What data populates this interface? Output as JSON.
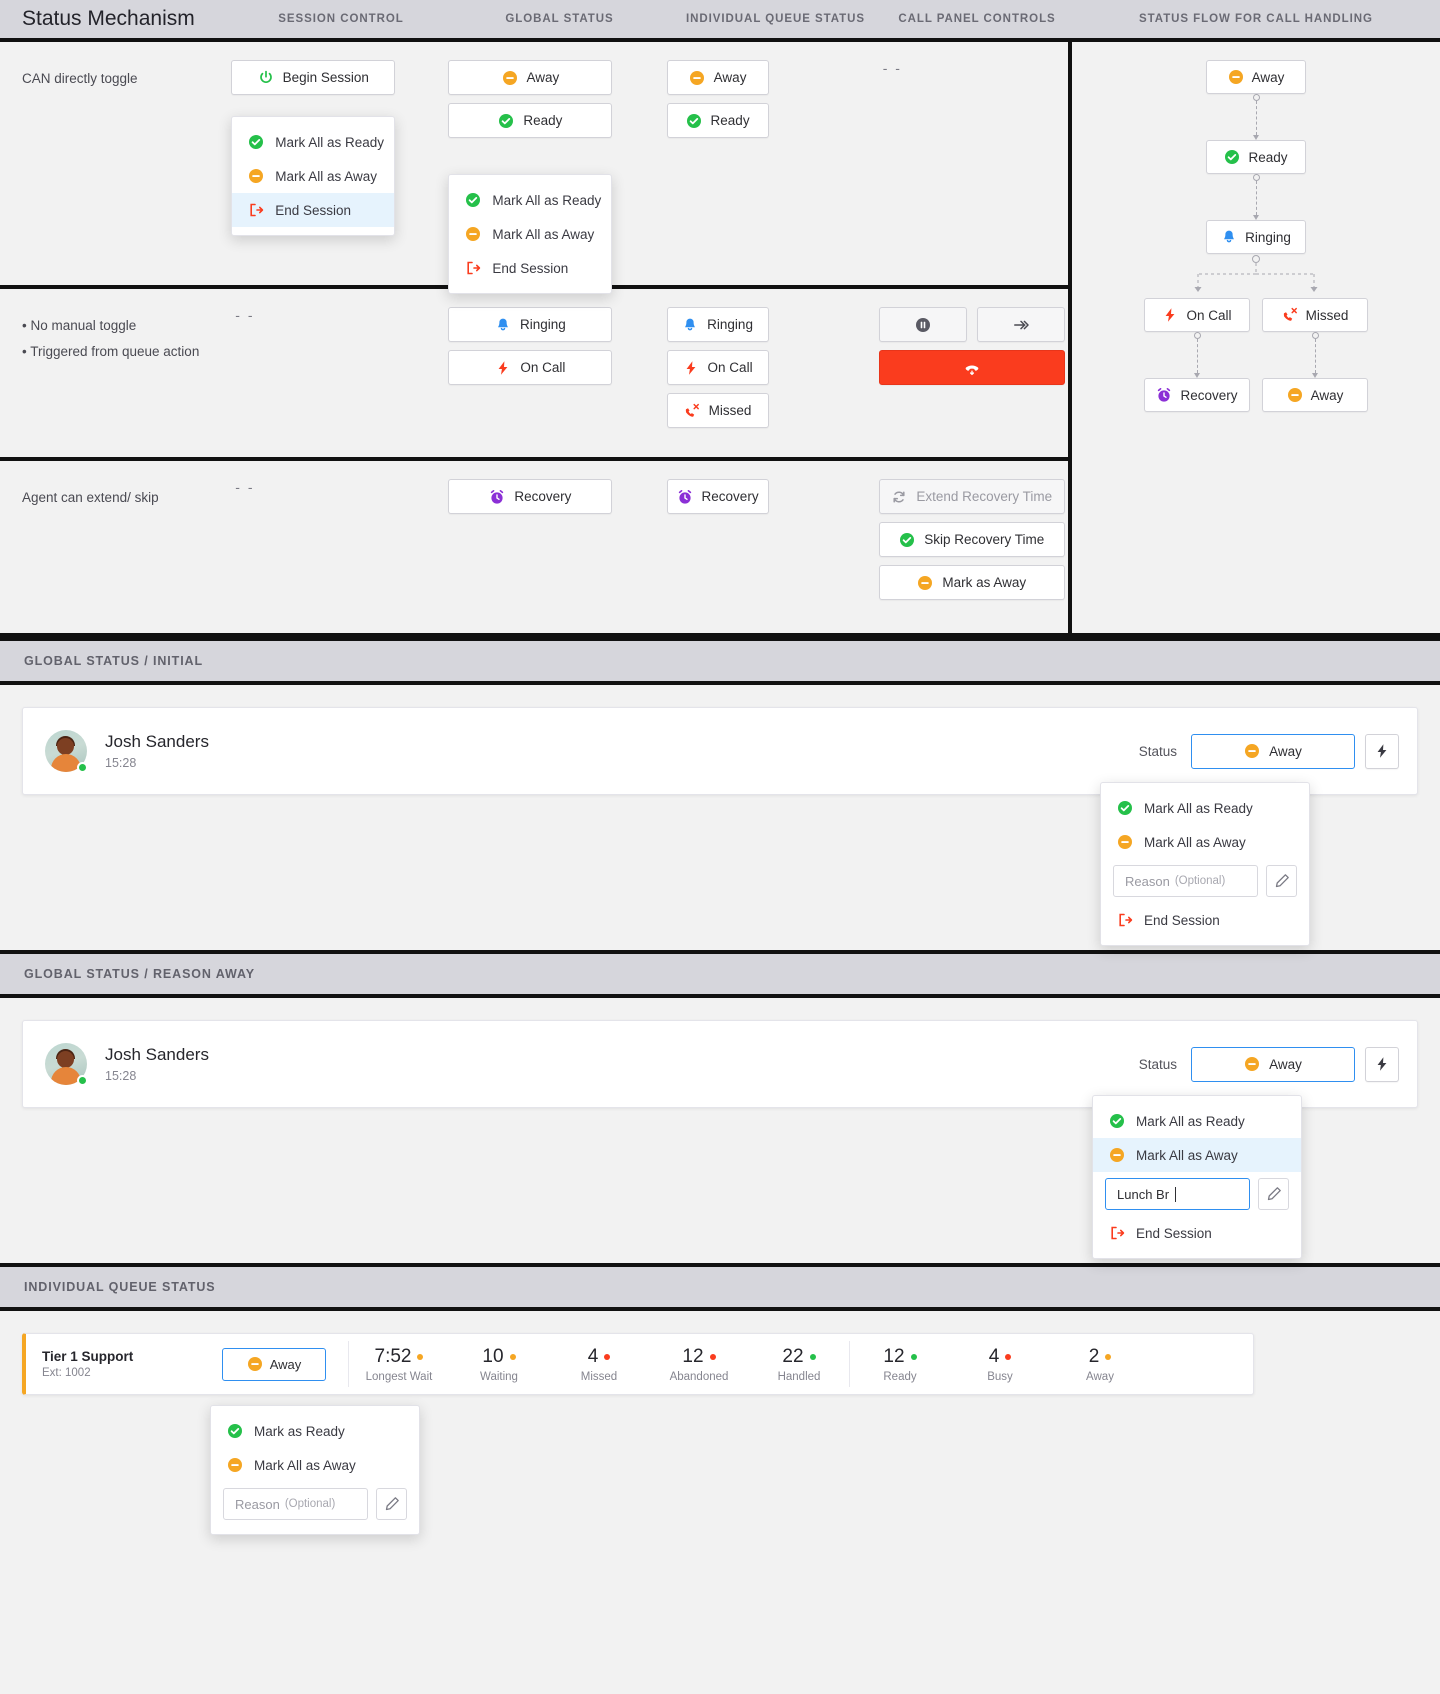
{
  "header": {
    "title": "Status Mechanism",
    "columns": [
      {
        "label": "SESSION CONTROL"
      },
      {
        "label": "GLOBAL STATUS"
      },
      {
        "label": "INDIVIDUAL QUEUE STATUS"
      },
      {
        "label": "CALL PANEL CONTROLS"
      },
      {
        "label": "STATUS FLOW FOR CALL HANDLING"
      }
    ]
  },
  "matrix": {
    "row1": {
      "label": "CAN directly toggle",
      "session": {
        "button": "Begin Session",
        "menu": [
          {
            "label": "Mark All as Ready",
            "icon": "check-circle-icon"
          },
          {
            "label": "Mark All as Away",
            "icon": "minus-circle-icon"
          },
          {
            "label": "End Session",
            "icon": "exit-icon",
            "highlighted": true
          }
        ]
      },
      "global": {
        "buttons": [
          {
            "label": "Away",
            "icon": "minus-circle-icon"
          },
          {
            "label": "Ready",
            "icon": "check-circle-icon"
          }
        ],
        "menu": [
          {
            "label": "Mark All as Ready",
            "icon": "check-circle-icon"
          },
          {
            "label": "Mark All as Away",
            "icon": "minus-circle-icon"
          },
          {
            "label": "End Session",
            "icon": "exit-icon"
          }
        ]
      },
      "queue": {
        "buttons": [
          {
            "label": "Away",
            "icon": "minus-circle-icon"
          },
          {
            "label": "Ready",
            "icon": "check-circle-icon"
          }
        ]
      },
      "panel_placeholder": "- -"
    },
    "row2": {
      "label_lines": [
        "• No manual toggle",
        "• Triggered from queue action"
      ],
      "session_placeholder": "- -",
      "global": {
        "buttons": [
          {
            "label": "Ringing",
            "icon": "bell-icon"
          },
          {
            "label": "On Call",
            "icon": "bolt-icon"
          }
        ]
      },
      "queue": {
        "buttons": [
          {
            "label": "Ringing",
            "icon": "bell-icon"
          },
          {
            "label": "On Call",
            "icon": "bolt-icon"
          },
          {
            "label": "Missed",
            "icon": "missed-call-icon"
          }
        ]
      },
      "panel": {
        "hold_icon": "pause-icon",
        "transfer_icon": "forward-icon",
        "hangup_icon": "hangup-icon"
      }
    },
    "row3": {
      "label": "Agent can extend/ skip",
      "session_placeholder": "- -",
      "global": {
        "buttons": [
          {
            "label": "Recovery",
            "icon": "alarm-icon"
          }
        ]
      },
      "queue": {
        "buttons": [
          {
            "label": "Recovery",
            "icon": "alarm-icon"
          }
        ]
      },
      "panel": {
        "buttons": [
          {
            "label": "Extend Recovery Time",
            "icon": "refresh-icon",
            "disabled": true
          },
          {
            "label": "Skip Recovery Time",
            "icon": "check-circle-icon"
          },
          {
            "label": "Mark as Away",
            "icon": "minus-circle-icon"
          }
        ]
      }
    }
  },
  "flow": {
    "nodes": [
      {
        "label": "Away",
        "icon": "minus-circle-icon"
      },
      {
        "label": "Ready",
        "icon": "check-circle-icon"
      },
      {
        "label": "Ringing",
        "icon": "bell-icon"
      }
    ],
    "branch_left": {
      "label": "On Call",
      "icon": "bolt-icon"
    },
    "branch_right": {
      "label": "Missed",
      "icon": "missed-call-icon"
    },
    "leaf_left": {
      "label": "Recovery",
      "icon": "alarm-icon"
    },
    "leaf_right": {
      "label": "Away",
      "icon": "minus-circle-icon"
    }
  },
  "section_initial": {
    "band": "GLOBAL STATUS / INITIAL",
    "agent": {
      "name": "Josh Sanders",
      "time": "15:28",
      "status_label": "Status",
      "status_value": "Away",
      "status_icon": "minus-circle-icon",
      "action_icon": "bolt-icon"
    },
    "menu": {
      "items": [
        {
          "label": "Mark All as Ready",
          "icon": "check-circle-icon"
        },
        {
          "label": "Mark All as Away",
          "icon": "minus-circle-icon"
        }
      ],
      "reason_placeholder": "Reason",
      "reason_optional": "(Optional)",
      "reason_value": "",
      "edit_icon": "pencil-icon",
      "end_session": "End Session",
      "end_session_icon": "exit-icon"
    }
  },
  "section_reason": {
    "band": "GLOBAL STATUS / REASON AWAY",
    "agent": {
      "name": "Josh Sanders",
      "time": "15:28",
      "status_label": "Status",
      "status_value": "Away",
      "status_icon": "minus-circle-icon",
      "action_icon": "bolt-icon"
    },
    "menu": {
      "items": [
        {
          "label": "Mark All as Ready",
          "icon": "check-circle-icon",
          "highlighted": false
        },
        {
          "label": "Mark All as Away",
          "icon": "minus-circle-icon",
          "highlighted": true
        }
      ],
      "reason_value": "Lunch Br",
      "edit_icon": "pencil-icon",
      "end_session": "End Session",
      "end_session_icon": "exit-icon"
    }
  },
  "section_queue": {
    "band": "INDIVIDUAL QUEUE STATUS",
    "queue": {
      "name": "Tier 1 Support",
      "ext": "Ext: 1002",
      "status_value": "Away",
      "status_icon": "minus-circle-icon"
    },
    "metrics": [
      {
        "value": "7:52",
        "label": "Longest Wait",
        "color": "#f5a623"
      },
      {
        "value": "10",
        "label": "Waiting",
        "color": "#f5a623"
      },
      {
        "value": "4",
        "label": "Missed",
        "color": "#fa3c1e"
      },
      {
        "value": "12",
        "label": "Abandoned",
        "color": "#fa3c1e"
      },
      {
        "value": "22",
        "label": "Handled",
        "color": "#25c04a"
      },
      {
        "value": "12",
        "label": "Ready",
        "color": "#25c04a"
      },
      {
        "value": "4",
        "label": "Busy",
        "color": "#fa3c1e"
      },
      {
        "value": "2",
        "label": "Away",
        "color": "#f5a623"
      }
    ],
    "menu": {
      "items": [
        {
          "label": "Mark as Ready",
          "icon": "check-circle-icon"
        },
        {
          "label": "Mark All as Away",
          "icon": "minus-circle-icon"
        }
      ],
      "reason_placeholder": "Reason",
      "reason_optional": "(Optional)",
      "edit_icon": "pencil-icon"
    }
  },
  "colors": {
    "away": "#f5a623",
    "ready": "#25c04a",
    "ringing": "#2f8ff0",
    "oncall": "#fa3c1e",
    "missed": "#fa3c1e",
    "recovery": "#8b2fd6",
    "accent": "#2f8ff0",
    "danger": "#fa3c1e"
  }
}
